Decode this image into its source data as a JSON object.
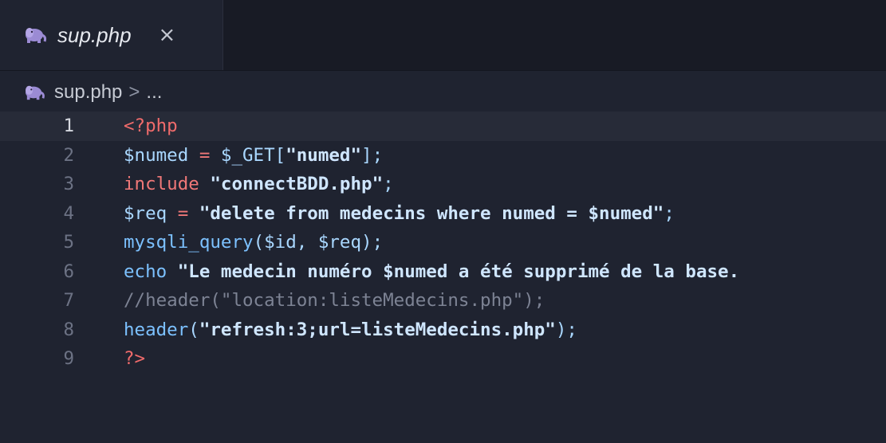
{
  "tab": {
    "title": "sup.php",
    "close_glyph": "×",
    "icon": "php-elephant-icon"
  },
  "breadcrumb": {
    "file": "sup.php",
    "separator": ">",
    "rest": "..."
  },
  "editor": {
    "active_line": 1,
    "lines": [
      {
        "n": "1",
        "tokens": [
          {
            "t": "<?php",
            "c": "tag"
          }
        ]
      },
      {
        "n": "2",
        "tokens": [
          {
            "t": "$numed",
            "c": "var"
          },
          {
            "t": " = ",
            "c": "op"
          },
          {
            "t": "$_GET",
            "c": "var"
          },
          {
            "t": "[",
            "c": "pun"
          },
          {
            "t": "\"numed\"",
            "c": "str"
          },
          {
            "t": "];",
            "c": "pun"
          }
        ]
      },
      {
        "n": "3",
        "tokens": [
          {
            "t": "include",
            "c": "kw"
          },
          {
            "t": " ",
            "c": "pun"
          },
          {
            "t": "\"connectBDD.php\"",
            "c": "str"
          },
          {
            "t": ";",
            "c": "pun"
          }
        ]
      },
      {
        "n": "4",
        "tokens": [
          {
            "t": "$req",
            "c": "var"
          },
          {
            "t": " = ",
            "c": "op"
          },
          {
            "t": "\"delete from medecins where numed = $numed\"",
            "c": "str"
          },
          {
            "t": ";",
            "c": "pun"
          }
        ]
      },
      {
        "n": "5",
        "tokens": [
          {
            "t": "mysqli_query",
            "c": "fn"
          },
          {
            "t": "($id, $req);",
            "c": "pun"
          }
        ]
      },
      {
        "n": "6",
        "tokens": [
          {
            "t": "echo",
            "c": "fn"
          },
          {
            "t": " ",
            "c": "pun"
          },
          {
            "t": "\"Le medecin numéro $numed a été supprimé de la base.",
            "c": "str"
          }
        ]
      },
      {
        "n": "7",
        "tokens": [
          {
            "t": "//header(\"location:listeMedecins.php\");",
            "c": "cm"
          }
        ]
      },
      {
        "n": "8",
        "tokens": [
          {
            "t": "header",
            "c": "fn"
          },
          {
            "t": "(",
            "c": "pun"
          },
          {
            "t": "\"refresh:3;url=listeMedecins.php\"",
            "c": "str"
          },
          {
            "t": ");",
            "c": "pun"
          }
        ]
      },
      {
        "n": "9",
        "tokens": [
          {
            "t": "?>",
            "c": "tag"
          }
        ]
      }
    ]
  },
  "colors": {
    "background": "#1f2330",
    "tabbar": "#181b25",
    "active_line": "#272b38",
    "php_icon": "#9b8bd4"
  }
}
